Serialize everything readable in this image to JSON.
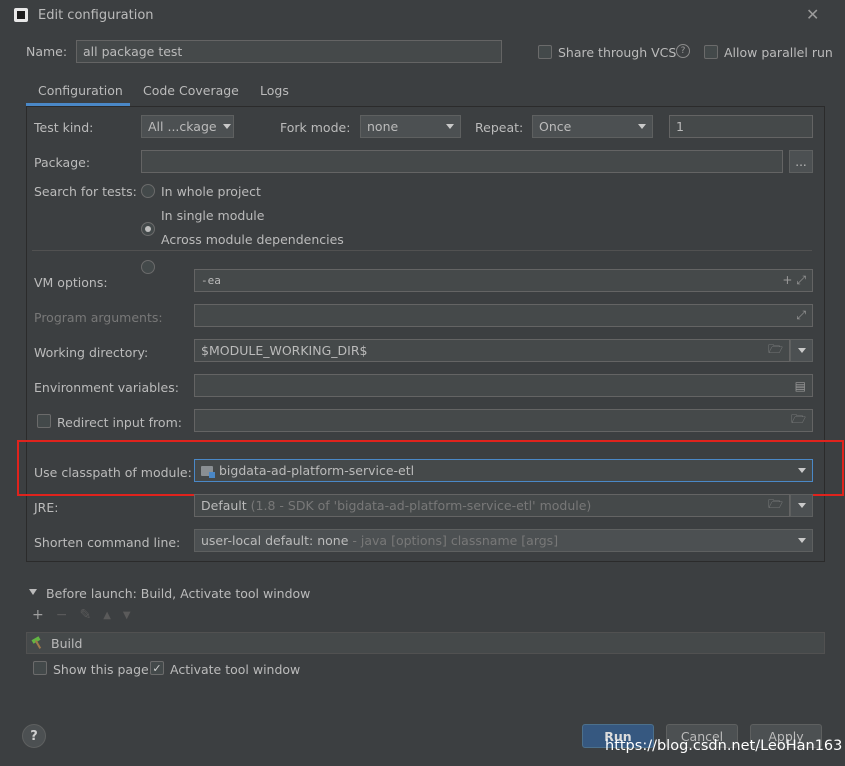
{
  "window": {
    "title": "Edit configuration"
  },
  "header": {
    "name_label": "Name:",
    "name_value": "all package test",
    "share_vcs_label": "Share through VCS",
    "allow_parallel_label": "Allow parallel run"
  },
  "tabs": [
    {
      "label": "Configuration"
    },
    {
      "label": "Code Coverage"
    },
    {
      "label": "Logs"
    }
  ],
  "config": {
    "test_kind_label": "Test kind:",
    "test_kind_value": "All ...ckage",
    "fork_mode_label": "Fork mode:",
    "fork_mode_value": "none",
    "repeat_label": "Repeat:",
    "repeat_value": "Once",
    "repeat_count": "1",
    "package_label": "Package:",
    "package_value": "",
    "browse_label": "...",
    "search_label": "Search for tests:",
    "search_options": [
      {
        "label": "In whole project"
      },
      {
        "label": "In single module"
      },
      {
        "label": "Across module dependencies"
      }
    ],
    "vm_options_label": "VM options:",
    "vm_options_value": "-ea",
    "program_args_label": "Program arguments:",
    "program_args_value": "",
    "working_dir_label": "Working directory:",
    "working_dir_value": "$MODULE_WORKING_DIR$",
    "env_vars_label": "Environment variables:",
    "env_vars_value": "",
    "redirect_label": "Redirect input from:",
    "redirect_value": "",
    "classpath_label": "Use classpath of module:",
    "classpath_value": "bigdata-ad-platform-service-etl",
    "jre_label": "JRE:",
    "jre_value": "Default",
    "jre_hint": "(1.8 - SDK of 'bigdata-ad-platform-service-etl' module)",
    "shorten_label": "Shorten command line:",
    "shorten_value": "user-local default: none",
    "shorten_hint": "- java [options] classname [args]"
  },
  "before_launch": {
    "title": "Before launch: Build, Activate tool window",
    "items": [
      {
        "label": "Build"
      }
    ],
    "show_page_label": "Show this page",
    "activate_tool_label": "Activate tool window"
  },
  "footer": {
    "help_label": "?",
    "run_label": "Run",
    "cancel_label": "Cancel",
    "apply_label": "Apply"
  },
  "watermark": "https://blog.csdn.net/LeoHan163",
  "colors": {
    "background": "#3c3f41",
    "accent": "#4a88c7",
    "highlight_box": "#e0231d",
    "primary_button": "#365880"
  }
}
